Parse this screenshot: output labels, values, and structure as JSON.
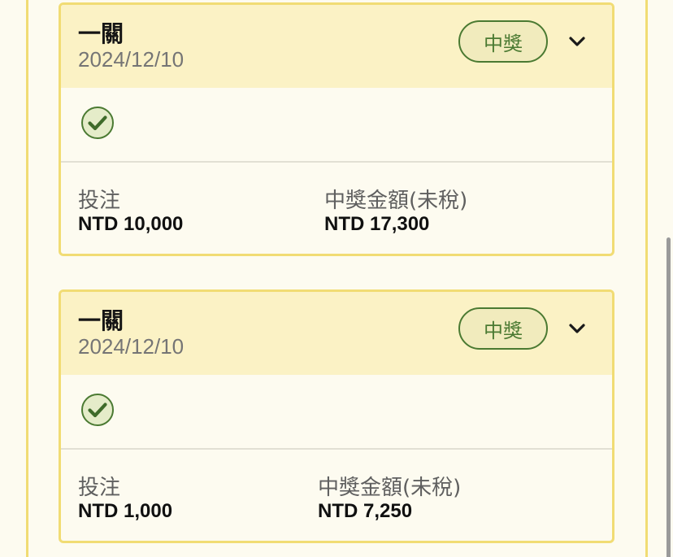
{
  "colors": {
    "border": "#f1dc74",
    "header_bg": "#fbf2c5",
    "badge_green": "#4b7a32",
    "page_bg": "#fdfbf0"
  },
  "bets": [
    {
      "title": "一關",
      "date": "2024/12/10",
      "status": "中獎",
      "status_icon": "check-circle-icon",
      "stake_label": "投注",
      "stake_value": "NTD 10,000",
      "payout_label": "中獎金額(未稅)",
      "payout_value": "NTD 17,300"
    },
    {
      "title": "一關",
      "date": "2024/12/10",
      "status": "中獎",
      "status_icon": "check-circle-icon",
      "stake_label": "投注",
      "stake_value": "NTD 1,000",
      "payout_label": "中獎金額(未稅)",
      "payout_value": "NTD 7,250"
    }
  ]
}
